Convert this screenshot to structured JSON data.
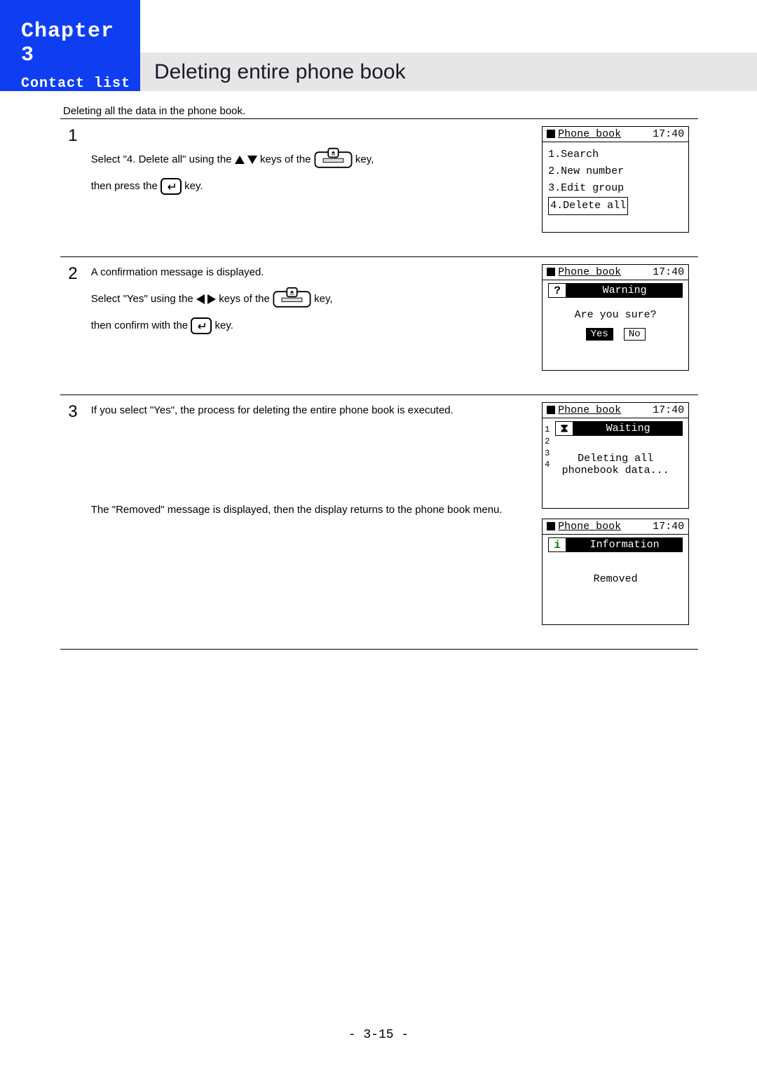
{
  "chapter": {
    "label": "Chapter 3",
    "section": "Contact list"
  },
  "title": "Deleting entire phone book",
  "intro": "Deleting all the data in the phone book.",
  "page_num": "- 3-15 -",
  "steps": [
    {
      "num": "1",
      "line1a": "Select \"4. Delete all\" using the ",
      "line1b": " keys of the ",
      "line1c": " key,",
      "line2a": "then press the ",
      "line2b": " key."
    },
    {
      "num": "2",
      "intro": "A confirmation message is displayed.",
      "line1a": "Select \"Yes\" using the ",
      "line1b": " keys of the ",
      "line1c": " key,",
      "line2a": "then confirm with the ",
      "line2b": " key."
    },
    {
      "num": "3",
      "line1": "If you select \"Yes\", the process for deleting the entire phone book is executed.",
      "line2": "The \"Removed\" message is displayed, then the display returns to the phone book menu."
    }
  ],
  "screens": {
    "s1": {
      "title": "Phone book",
      "time": "17:40",
      "items": [
        "1.Search",
        "2.New number",
        "3.Edit group",
        "4.Delete all"
      ],
      "sel_idx": 3
    },
    "s2": {
      "title": "Phone book",
      "time": "17:40",
      "banner": "Warning",
      "msg": "Are you sure?",
      "yes": "Yes",
      "no": "No"
    },
    "s3": {
      "title": "Phone book",
      "time": "17:40",
      "banner": "Waiting",
      "msg1": "Deleting all",
      "msg2": "phonebook data..."
    },
    "s4": {
      "title": "Phone book",
      "time": "17:40",
      "banner": "Information",
      "msg": "Removed"
    }
  }
}
